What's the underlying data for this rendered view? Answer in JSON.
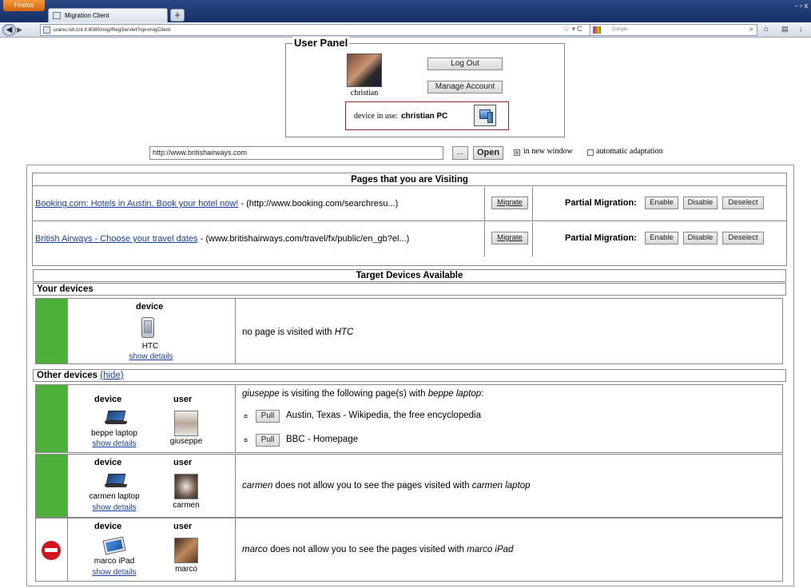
{
  "browser": {
    "app_button": "Firefox",
    "tab_title": "Migration Client",
    "new_tab": "+",
    "url": "urano.isti.cnr.it:8080/mig/RegServlet?op=migClient",
    "search_placeholder": "Google",
    "window_controls": "- ▫ x"
  },
  "user_panel": {
    "title": "User Panel",
    "username": "christian",
    "logout_label": "Log Out",
    "manage_label": "Manage Account",
    "device_in_use_label": "device in use:",
    "device_in_use_value": "christian PC"
  },
  "open_bar": {
    "url_value": "http://www.britishairways.com",
    "browse_label": "...",
    "open_label": "Open",
    "new_window_label": "in new window",
    "new_window_checked": true,
    "auto_adapt_label": "automatic adaptation",
    "auto_adapt_checked": false
  },
  "pages": {
    "header": "Pages that you are Visiting",
    "rows": [
      {
        "title": "Booking.com: Hotels in Austin. Book your hotel now!",
        "sep": " - ",
        "url": "(http://www.booking.com/searchresu...)"
      },
      {
        "title": "British Airways - Choose your travel dates",
        "sep": " - ",
        "url": "(www.britishairways.com/travel/fx/public/en_gb?el...)"
      }
    ],
    "migrate_label": "Migrate",
    "partial_label": "Partial Migration:",
    "enable_label": "Enable",
    "disable_label": "Disable",
    "deselect_label": "Deselect"
  },
  "targets": {
    "header": "Target Devices Available",
    "your_devices_label": "Your devices",
    "other_devices_label": "Other devices",
    "hide_label": "(hide)",
    "device_col": "device",
    "user_col": "user",
    "show_details": "show details",
    "your": {
      "device_name": "HTC",
      "message_prefix": "no page is visited with ",
      "message_device": "HTC"
    },
    "others": [
      {
        "device_name": "beppe laptop",
        "user": "giuseppe",
        "status": "allowed",
        "message_user": "giuseppe",
        "message_mid": " is visiting the following page(s) with ",
        "message_device": "beppe laptop",
        "message_end": ":",
        "pages": [
          "Austin, Texas - Wikipedia, the free encyclopedia",
          "BBC - Homepage"
        ],
        "pull_label": "Pull",
        "bullet": "¤"
      },
      {
        "device_name": "carmen laptop",
        "user": "carmen",
        "status": "allowed",
        "message_user": "carmen",
        "message_mid": " does not allow you to see the pages visited with ",
        "message_device": "carmen laptop"
      },
      {
        "device_name": "marco iPad",
        "user": "marco",
        "status": "blocked",
        "message_user": "marco",
        "message_mid": " does not allow you to see the pages visited with ",
        "message_device": "marco iPad"
      }
    ]
  },
  "colors": {
    "available": "#4caf3a",
    "blocked": "#d4141c",
    "link": "#1a3ea0"
  },
  "icons": [
    "firefox-logo",
    "back-arrow-icon",
    "forward-arrow-icon",
    "bookmark-star-icon",
    "reload-icon",
    "google-icon",
    "search-icon",
    "home-icon",
    "bookmarks-icon",
    "download-icon",
    "pc-icon",
    "phone-icon",
    "laptop-icon",
    "ipad-icon",
    "no-entry-icon"
  ]
}
